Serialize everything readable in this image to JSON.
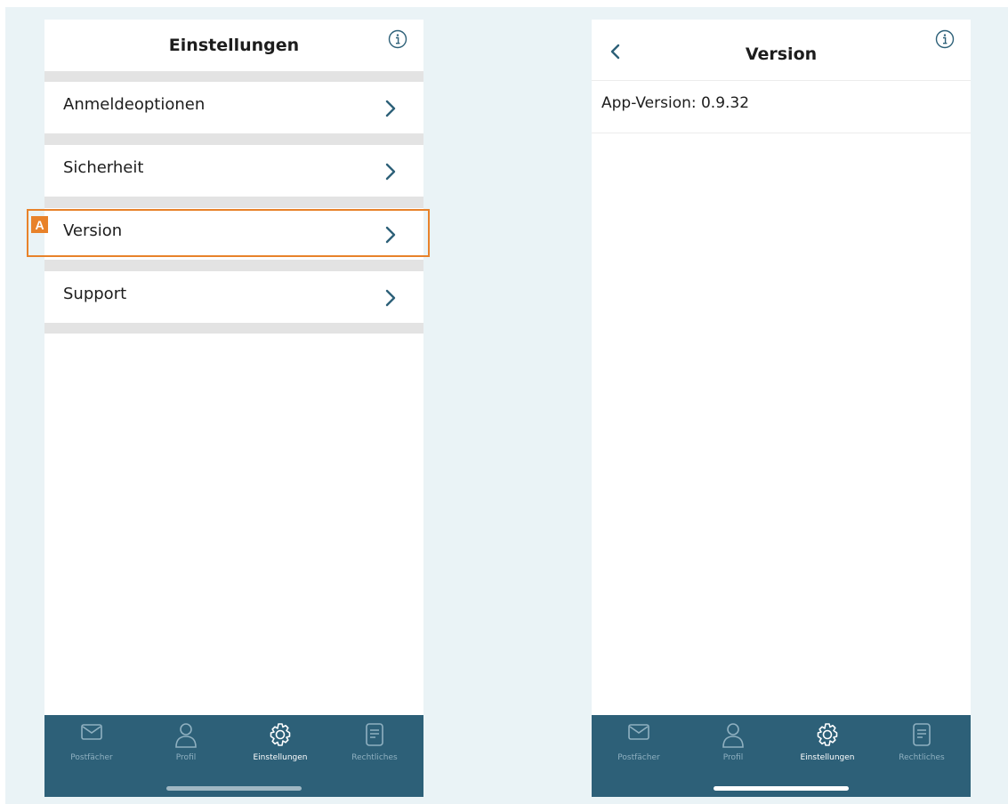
{
  "left_screen": {
    "title": "Einstellungen",
    "items": [
      {
        "label": "Anmeldeoptionen"
      },
      {
        "label": "Sicherheit"
      },
      {
        "label": "Version"
      },
      {
        "label": "Support"
      }
    ],
    "callout_badge": "A"
  },
  "right_screen": {
    "title": "Version",
    "app_version": "App-Version: 0.9.32"
  },
  "tabbar": {
    "tabs": [
      {
        "label": "Postfächer",
        "icon": "mail-icon"
      },
      {
        "label": "Profil",
        "icon": "person-icon"
      },
      {
        "label": "Einstellungen",
        "icon": "gear-icon",
        "active": true
      },
      {
        "label": "Rechtliches",
        "icon": "document-icon"
      }
    ]
  },
  "colors": {
    "tabbar_bg": "#2d6078",
    "accent_chevron": "#2d6078",
    "callout": "#e8822a",
    "separator": "#e3e3e3"
  }
}
